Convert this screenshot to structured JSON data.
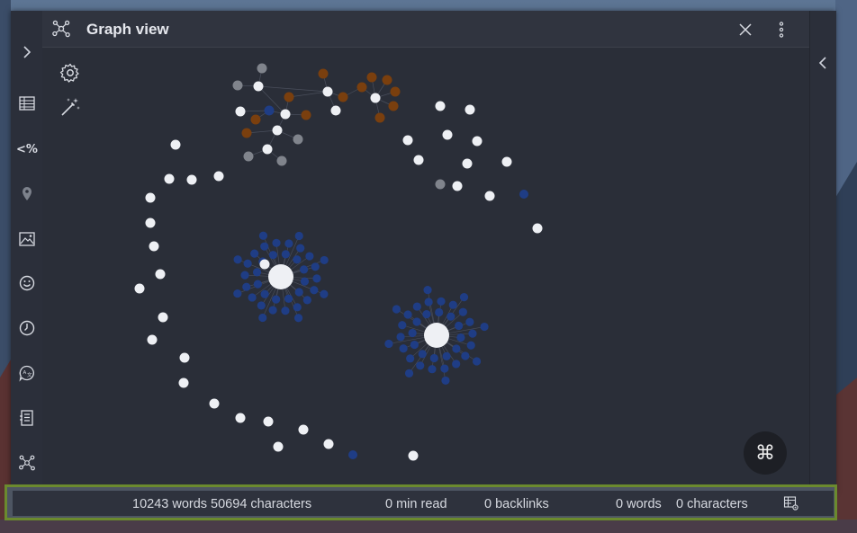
{
  "window": {
    "title": "Graph view"
  },
  "left_ribbon": {
    "items": [
      {
        "icon": "chevron-right-icon"
      },
      {
        "icon": "table-icon"
      },
      {
        "icon": "percent-code-icon",
        "glyph": "<%"
      },
      {
        "icon": "map-pin-icon"
      },
      {
        "icon": "image-icon"
      },
      {
        "icon": "smiley-icon"
      },
      {
        "icon": "clock-icon"
      },
      {
        "icon": "translate-icon"
      },
      {
        "icon": "form-icon"
      },
      {
        "icon": "graph-icon"
      }
    ]
  },
  "graph": {
    "colors": {
      "note": "#eef0f4",
      "tag": "#1f3d85",
      "attachment": "#7a3f0e",
      "unresolved": "#80848c",
      "link": "#4a4f5c"
    }
  },
  "command_button": {
    "glyph": "⌘"
  },
  "status_bar": {
    "vault_words": "10243 words 50694 characters",
    "read_time": "0 min read",
    "backlinks": "0 backlinks",
    "note_words": "0 words",
    "note_chars": "0 characters"
  }
}
